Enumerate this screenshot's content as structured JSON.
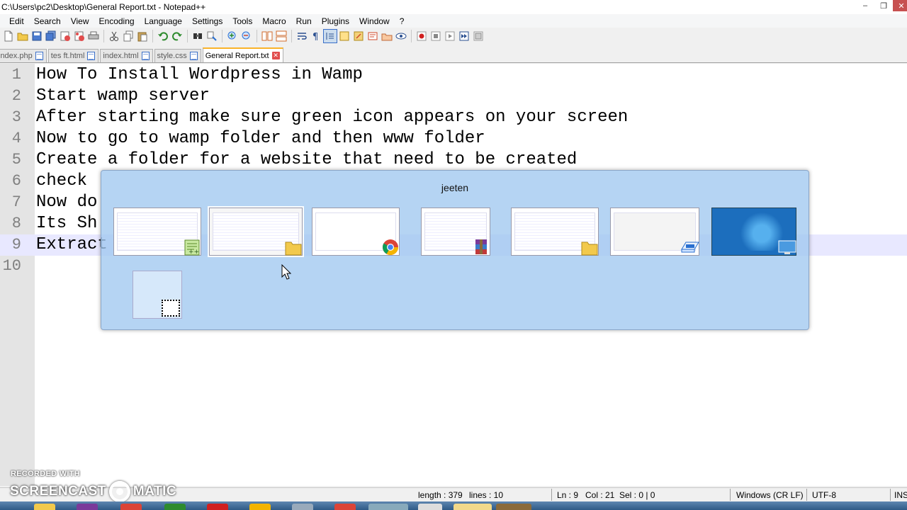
{
  "window": {
    "title": "C:\\Users\\pc2\\Desktop\\General Report.txt - Notepad++"
  },
  "menu": [
    "Edit",
    "Search",
    "View",
    "Encoding",
    "Language",
    "Settings",
    "Tools",
    "Macro",
    "Run",
    "Plugins",
    "Window",
    "?"
  ],
  "toolbar_icons": [
    "new-file-icon",
    "open-file-icon",
    "save-icon",
    "save-all-icon",
    "close-icon",
    "close-all-icon",
    "print-icon",
    "cut-icon",
    "copy-icon",
    "paste-icon",
    "undo-icon",
    "redo-icon",
    "find-icon",
    "replace-icon",
    "zoom-in-icon",
    "zoom-out-icon",
    "sync-v-icon",
    "sync-h-icon",
    "wrap-icon",
    "show-all-chars-icon",
    "indent-guide-icon",
    "doc-map-icon",
    "function-list-icon",
    "folder-workspace-icon",
    "monitor-icon",
    "record-macro-icon",
    "stop-macro-icon",
    "play-macro-icon",
    "run-macro-multiple-icon",
    "save-macro-icon"
  ],
  "tabs": [
    {
      "label": "index.php",
      "active": false
    },
    {
      "label": "tes ft.html",
      "active": false
    },
    {
      "label": "index.html",
      "active": false
    },
    {
      "label": "style.css",
      "active": false
    },
    {
      "label": "General Report.txt",
      "active": true
    }
  ],
  "editor": {
    "lines": [
      {
        "n": "1",
        "text": "How To Install Wordpress in Wamp"
      },
      {
        "n": "2",
        "text": "Start wamp server"
      },
      {
        "n": "3",
        "text": "After starting make sure green icon appears on your screen"
      },
      {
        "n": "4",
        "text": "Now to go to wamp folder and then www folder"
      },
      {
        "n": "5",
        "text": "Create a folder for a website that need to be created"
      },
      {
        "n": "6",
        "text": "check"
      },
      {
        "n": "7",
        "text": "Now do"
      },
      {
        "n": "8",
        "text": "Its Sh"
      },
      {
        "n": "9",
        "text": "Extract"
      },
      {
        "n": "10",
        "text": ""
      }
    ],
    "current_line": 9
  },
  "switcher": {
    "title": "jeeten",
    "windows": [
      {
        "name": "notepad-plus-plus",
        "icon": "notepad-plus-plus-icon",
        "selected": false
      },
      {
        "name": "explorer-1",
        "icon": "folder-icon",
        "selected": true
      },
      {
        "name": "chrome",
        "icon": "chrome-icon",
        "selected": false
      },
      {
        "name": "winrar",
        "icon": "winrar-icon",
        "selected": false
      },
      {
        "name": "explorer-2",
        "icon": "folder-icon",
        "selected": false
      },
      {
        "name": "run-dialog",
        "icon": "run-icon",
        "selected": false
      },
      {
        "name": "desktop",
        "icon": "desktop-icon",
        "selected": false
      }
    ]
  },
  "status": {
    "length": "length : 379",
    "lines": "lines : 10",
    "ln": "Ln : 9",
    "col": "Col : 21",
    "sel": "Sel : 0 | 0",
    "eol": "Windows (CR LF)",
    "encoding": "UTF-8",
    "mode": "INS"
  },
  "watermark": {
    "recorded_with": "RECORDED WITH",
    "brand_left": "SCREENCAST",
    "brand_right": "MATIC"
  },
  "colors": {
    "accent_tab": "#fab32a",
    "current_line": "#e8e8ff",
    "switcher_bg": "#a0c8f0"
  }
}
